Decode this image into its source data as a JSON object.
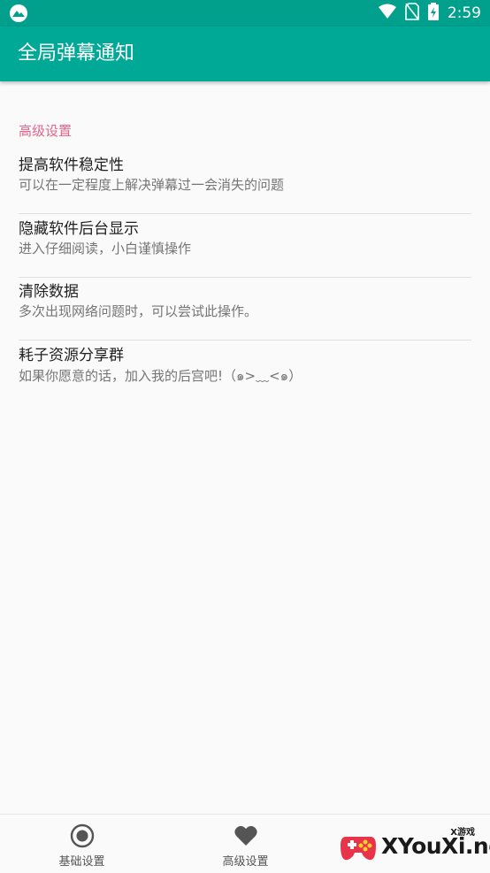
{
  "status_bar": {
    "time": "2:59"
  },
  "app_bar": {
    "title": "全局弹幕通知"
  },
  "section": {
    "header": "高级设置",
    "items": [
      {
        "title": "提高软件稳定性",
        "summary": "可以在一定程度上解决弹幕过一会消失的问题"
      },
      {
        "title": "隐藏软件后台显示",
        "summary": "进入仔细阅读，小白谨慎操作"
      },
      {
        "title": "清除数据",
        "summary": "多次出现网络问题时，可以尝试此操作。"
      },
      {
        "title": "耗子资源分享群",
        "summary": "如果你愿意的话，加入我的后宫吧!（๑>﹏<๑）"
      }
    ]
  },
  "bottom_nav": {
    "items": [
      {
        "label": "基础设置",
        "icon": "radio-button-icon"
      },
      {
        "label": "高级设置",
        "icon": "heart-icon"
      }
    ]
  },
  "watermark": {
    "text": "XYouXi.net",
    "small": "X游戏"
  },
  "colors": {
    "primary": "#00a896",
    "status_bar": "#00a08c",
    "accent": "#e4648c"
  }
}
